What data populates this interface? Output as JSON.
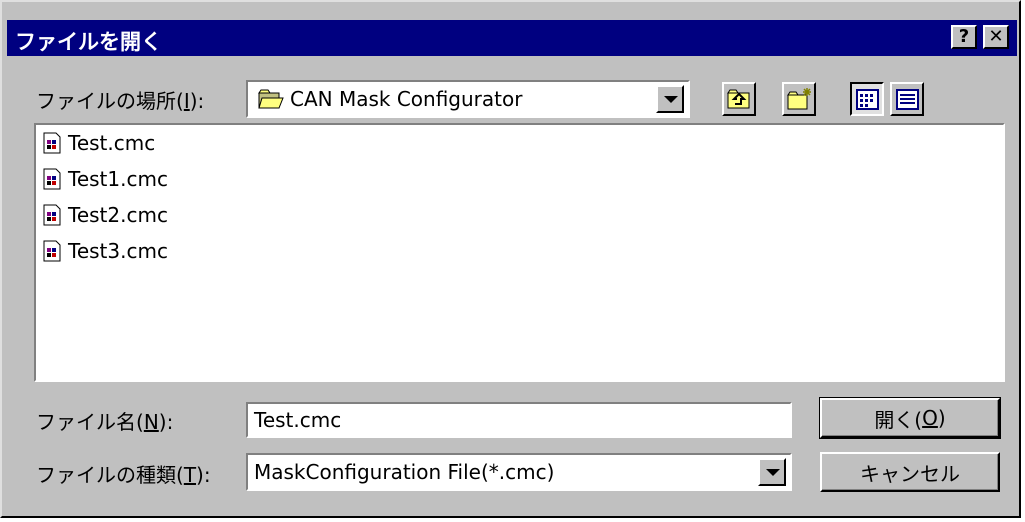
{
  "window": {
    "title": "ファイルを開く",
    "help_label": "?",
    "close_label": "✕"
  },
  "location": {
    "label": "ファイルの場所(I):",
    "label_main": "ファイルの場所(",
    "label_key": "I",
    "label_tail": "):",
    "value": "CAN Mask Configurator"
  },
  "toolbar": {
    "up_folder": "up-folder-icon",
    "new_folder": "new-folder-icon",
    "list_view": "list-view-icon",
    "details_view": "details-view-icon"
  },
  "files": [
    {
      "name": "Test.cmc"
    },
    {
      "name": "Test1.cmc"
    },
    {
      "name": "Test2.cmc"
    },
    {
      "name": "Test3.cmc"
    }
  ],
  "filename": {
    "label_main": "ファイル名(",
    "label_key": "N",
    "label_tail": "):",
    "value": "Test.cmc"
  },
  "filetype": {
    "label_main": "ファイルの種類(",
    "label_key": "T",
    "label_tail": "):",
    "value": "MaskConfiguration File(*.cmc)"
  },
  "buttons": {
    "open_main": "開く(",
    "open_key": "O",
    "open_tail": ")",
    "cancel": "キャンセル"
  },
  "colors": {
    "titlebar": "#000080",
    "face": "#c0c0c0",
    "window": "#ffffff"
  }
}
